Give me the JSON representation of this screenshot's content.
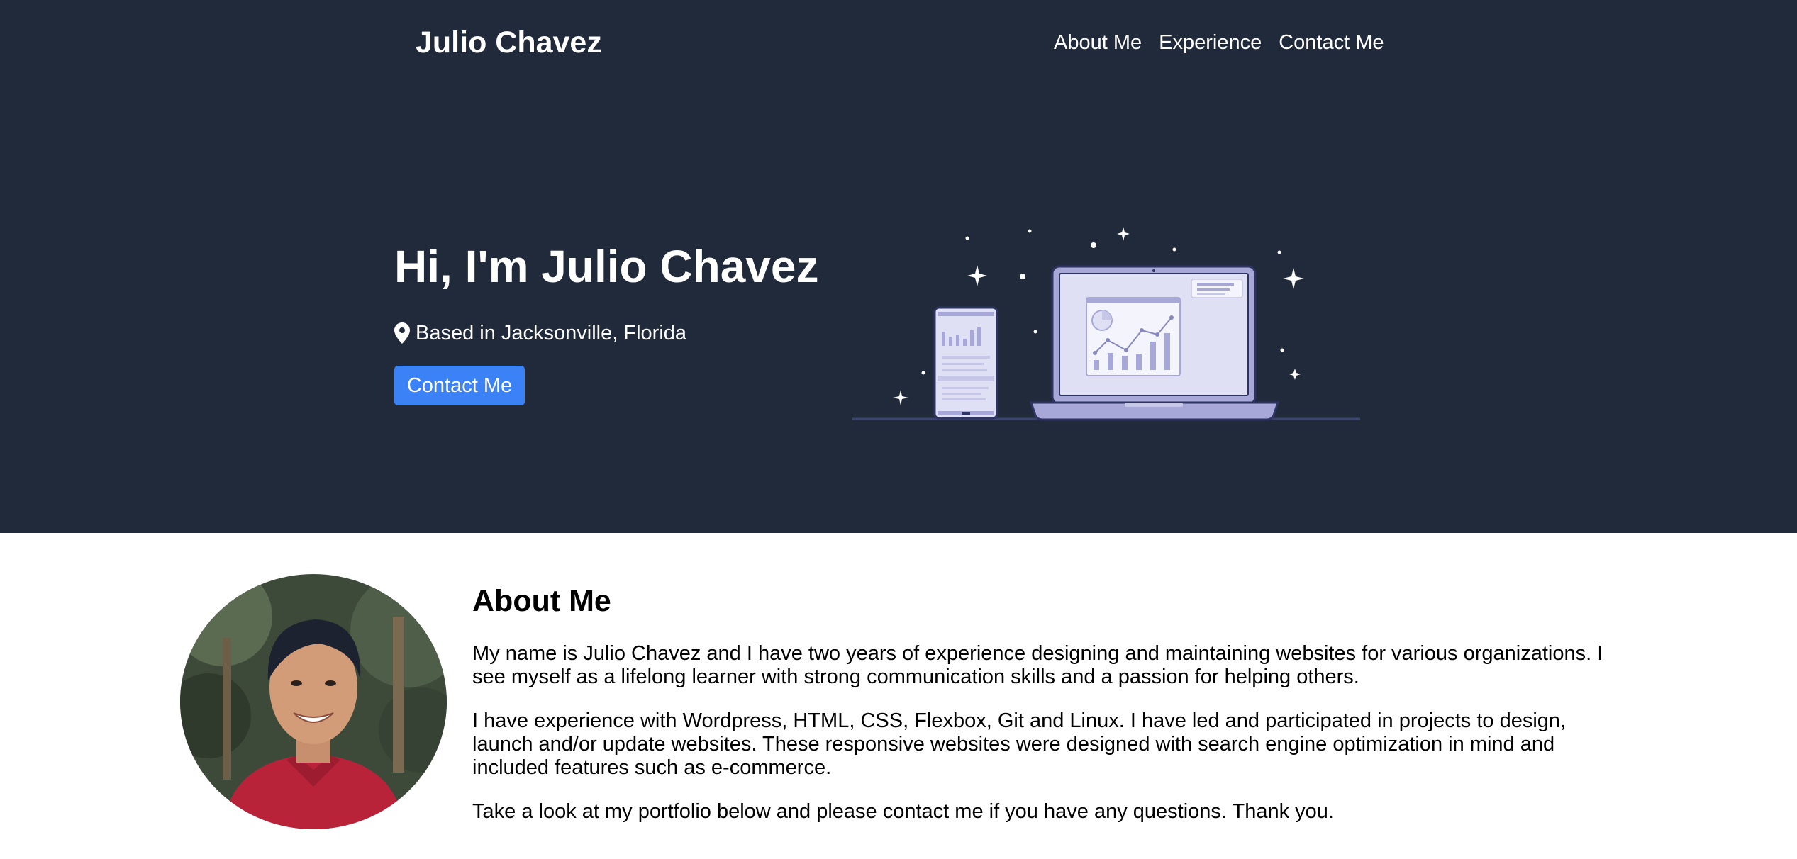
{
  "header": {
    "brand": "Julio Chavez",
    "nav": [
      "About Me",
      "Experience",
      "Contact Me"
    ]
  },
  "hero": {
    "title": "Hi, I'm Julio Chavez",
    "location": "Based in Jacksonville, Florida",
    "location_icon": "map-marker-icon",
    "cta_label": "Contact Me"
  },
  "about": {
    "heading": "About Me",
    "paragraphs": [
      "My name is Julio Chavez and I have two years of experience designing and maintaining websites for various organizations. I see myself as a lifelong learner with strong communication skills and a passion for helping others.",
      "I have experience with Wordpress, HTML, CSS, Flexbox, Git and Linux. I have led and participated in projects to design, launch and/or update websites. These responsive websites were designed with search engine optimization in mind and included features such as e-commerce.",
      "Take a look at my portfolio below and please contact me if you have any questions. Thank you."
    ]
  },
  "colors": {
    "hero_bg": "#212a3a",
    "accent": "#3b82f6",
    "illustration_light": "#e0e0f5",
    "illustration_mid": "#a8a8d8",
    "illustration_dark": "#2e3462"
  }
}
